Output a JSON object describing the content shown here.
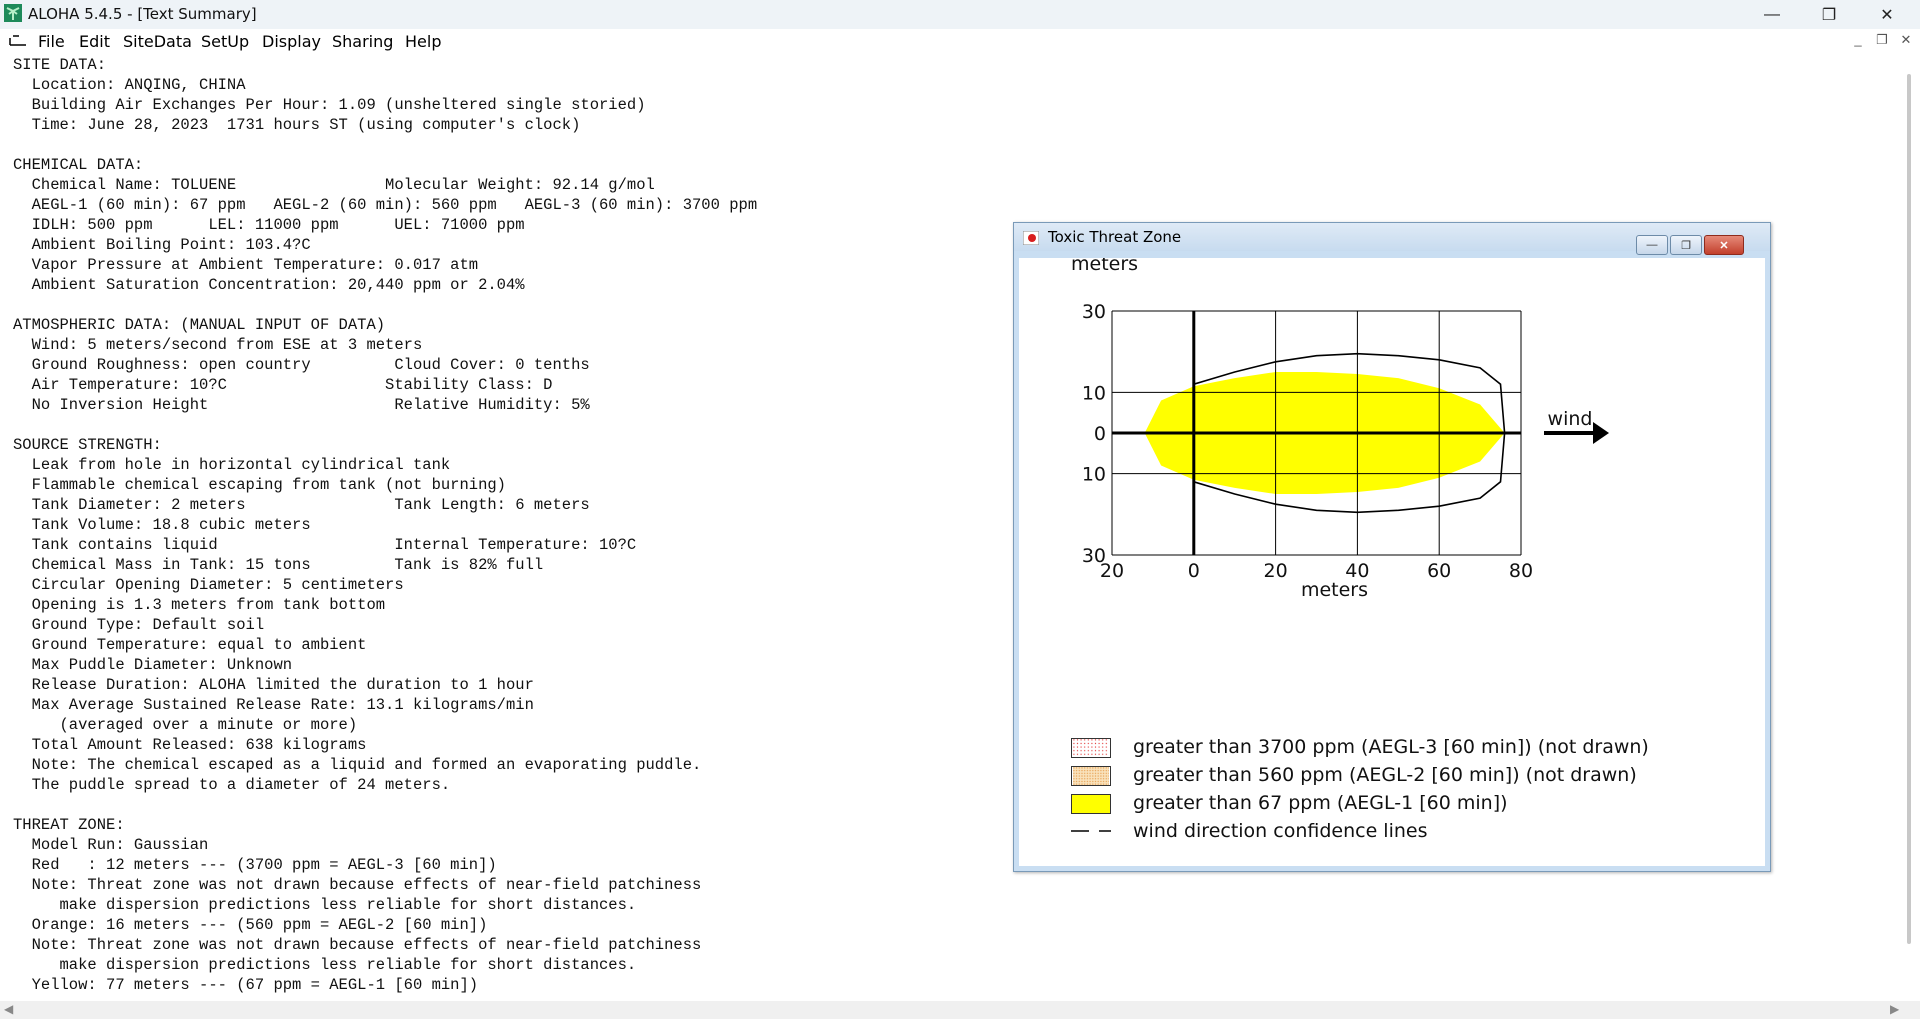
{
  "window": {
    "title": "ALOHA 5.4.5 - [Text Summary]",
    "minimize": "—",
    "restore": "❐",
    "close": "✕"
  },
  "menu": {
    "items": [
      "File",
      "Edit",
      "SiteData",
      "SetUp",
      "Display",
      "Sharing",
      "Help"
    ],
    "mdi_min": "_",
    "mdi_restore": "❐",
    "mdi_close": "✕"
  },
  "summary_lines": [
    "SITE DATA:",
    "  Location: ANQING, CHINA",
    "  Building Air Exchanges Per Hour: 1.09 (unsheltered single storied)",
    "  Time: June 28, 2023  1731 hours ST (using computer's clock)",
    "",
    "CHEMICAL DATA:",
    "  Chemical Name: TOLUENE                Molecular Weight: 92.14 g/mol",
    "  AEGL-1 (60 min): 67 ppm   AEGL-2 (60 min): 560 ppm   AEGL-3 (60 min): 3700 ppm",
    "  IDLH: 500 ppm      LEL: 11000 ppm      UEL: 71000 ppm",
    "  Ambient Boiling Point: 103.4?C",
    "  Vapor Pressure at Ambient Temperature: 0.017 atm",
    "  Ambient Saturation Concentration: 20,440 ppm or 2.04%",
    "",
    "ATMOSPHERIC DATA: (MANUAL INPUT OF DATA)",
    "  Wind: 5 meters/second from ESE at 3 meters",
    "  Ground Roughness: open country         Cloud Cover: 0 tenths",
    "  Air Temperature: 10?C                 Stability Class: D",
    "  No Inversion Height                    Relative Humidity: 5%",
    "",
    "SOURCE STRENGTH:",
    "  Leak from hole in horizontal cylindrical tank",
    "  Flammable chemical escaping from tank (not burning)",
    "  Tank Diameter: 2 meters                Tank Length: 6 meters",
    "  Tank Volume: 18.8 cubic meters",
    "  Tank contains liquid                   Internal Temperature: 10?C",
    "  Chemical Mass in Tank: 15 tons         Tank is 82% full",
    "  Circular Opening Diameter: 5 centimeters",
    "  Opening is 1.3 meters from tank bottom",
    "  Ground Type: Default soil",
    "  Ground Temperature: equal to ambient",
    "  Max Puddle Diameter: Unknown",
    "  Release Duration: ALOHA limited the duration to 1 hour",
    "  Max Average Sustained Release Rate: 13.1 kilograms/min",
    "     (averaged over a minute or more)",
    "  Total Amount Released: 638 kilograms",
    "  Note: The chemical escaped as a liquid and formed an evaporating puddle.",
    "  The puddle spread to a diameter of 24 meters.",
    "",
    "THREAT ZONE:",
    "  Model Run: Gaussian",
    "  Red   : 12 meters --- (3700 ppm = AEGL-3 [60 min])",
    "  Note: Threat zone was not drawn because effects of near-field patchiness",
    "     make dispersion predictions less reliable for short distances.",
    "  Orange: 16 meters --- (560 ppm = AEGL-2 [60 min])",
    "  Note: Threat zone was not drawn because effects of near-field patchiness",
    "     make dispersion predictions less reliable for short distances.",
    "  Yellow: 77 meters --- (67 ppm = AEGL-1 [60 min])"
  ],
  "threat_window": {
    "title": "Toxic Threat Zone",
    "min": "—",
    "restore": "❐",
    "close": "✕",
    "wind_label": "wind",
    "legend": [
      {
        "text": "greater than 3700 ppm (AEGL-3 [60 min]) (not drawn)",
        "color": "#ffffff",
        "pattern": "red-dots"
      },
      {
        "text": "greater than 560 ppm (AEGL-2 [60 min]) (not drawn)",
        "color": "#f7d9a8",
        "pattern": "orange-dots"
      },
      {
        "text": "greater than 67 ppm (AEGL-1 [60 min])",
        "color": "#ffff00",
        "pattern": "solid"
      },
      {
        "text": "wind direction confidence lines",
        "color": "#000000",
        "pattern": "dashed-line"
      }
    ]
  },
  "chart_data": {
    "type": "area",
    "title": "",
    "xlabel": "meters",
    "ylabel": "meters",
    "xlim": [
      -20,
      80
    ],
    "ylim": [
      -30,
      30
    ],
    "x_ticks": [
      -20,
      0,
      20,
      40,
      60,
      80
    ],
    "x_tick_labels": [
      "20",
      "0",
      "20",
      "40",
      "60",
      "80"
    ],
    "y_ticks": [
      30,
      10,
      0,
      -10,
      -30
    ],
    "y_tick_labels": [
      "30",
      "10",
      "0",
      "10",
      "30"
    ],
    "grid": true,
    "series": [
      {
        "name": "greater than 67 ppm (AEGL-1 [60 min])",
        "color": "#ffff00",
        "x": [
          -12,
          -8,
          0,
          10,
          20,
          30,
          40,
          50,
          60,
          70,
          76
        ],
        "y_half_width": [
          0,
          8,
          11.5,
          13.5,
          15,
          15,
          14.5,
          13.5,
          11,
          7,
          0
        ]
      },
      {
        "name": "wind direction confidence lines",
        "color": "#000000",
        "x": [
          0,
          10,
          20,
          30,
          40,
          50,
          60,
          70,
          75,
          76
        ],
        "y_half_width": [
          12,
          15,
          17.5,
          19,
          19.5,
          19,
          18,
          16,
          12,
          0
        ]
      }
    ]
  }
}
